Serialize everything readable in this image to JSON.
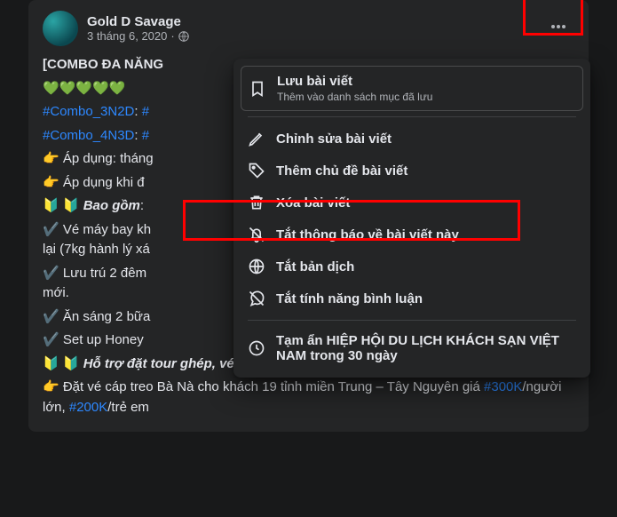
{
  "post": {
    "author": "Gold D Savage",
    "date": "3 tháng 6, 2020",
    "privacy_icon": "globe",
    "lines": [
      "[COMBO ĐA NĂNG",
      "💚💚💚💚💚",
      "#Combo_3N2D: #",
      "#Combo_4N3D: #",
      "👉 Áp dụng: tháng",
      "👉 Áp dụng khi đ",
      "🔰 🔰 Bao gồm:",
      "✔️ Vé máy bay kh",
      "lại (7kg hành lý xá",
      "✔️ Lưu trú 2 đêm",
      "mới.",
      "✔️ Ăn sáng 2 bữa",
      "✔️ Set up Honey",
      "🔰 🔰 Hỗ trợ đặt tour ghép, vé thăm quan giá siêu rẻ, siêu chất:",
      "👉 Đặt vé cáp treo Bà Nà cho khách 19 tỉnh miền Trung – Tây Nguyên giá #300K/người lớn, #200K/trẻ em"
    ]
  },
  "menu": {
    "save": {
      "label": "Lưu bài viết",
      "sub": "Thêm vào danh sách mục đã lưu"
    },
    "edit": {
      "label": "Chỉnh sửa bài viết"
    },
    "topic": {
      "label": "Thêm chủ đề bài viết"
    },
    "delete": {
      "label": "Xóa bài viết"
    },
    "notif_off": {
      "label": "Tắt thông báo về bài viết này"
    },
    "translate_off": {
      "label": "Tắt bản dịch"
    },
    "comment_off": {
      "label": "Tắt tính năng bình luận"
    },
    "snooze": {
      "label": "Tạm ẩn HIỆP HỘI DU LỊCH KHÁCH SẠN VIỆT NAM trong 30 ngày"
    }
  }
}
